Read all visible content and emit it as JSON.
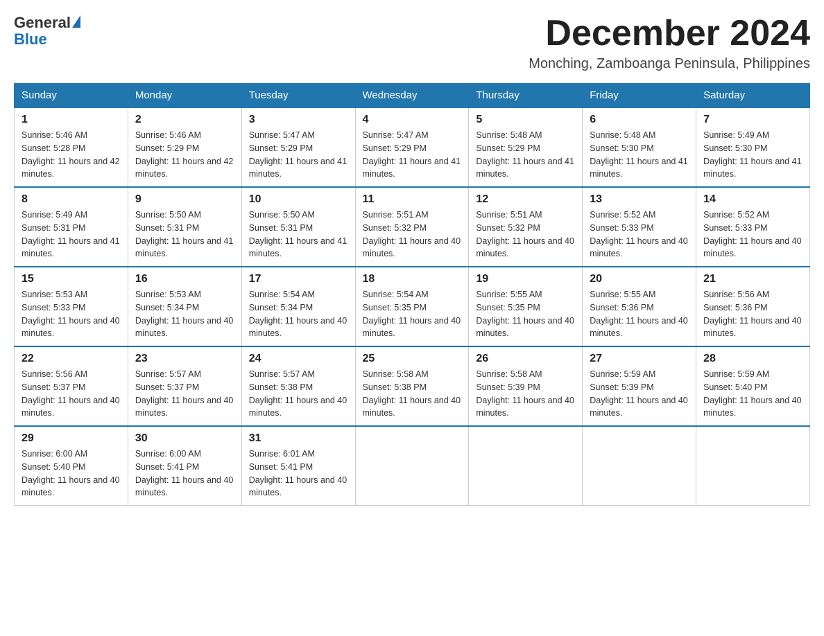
{
  "header": {
    "logo": {
      "text_general": "General",
      "triangle": "▶",
      "text_blue": "Blue"
    },
    "month_title": "December 2024",
    "location": "Monching, Zamboanga Peninsula, Philippines"
  },
  "weekdays": [
    "Sunday",
    "Monday",
    "Tuesday",
    "Wednesday",
    "Thursday",
    "Friday",
    "Saturday"
  ],
  "weeks": [
    [
      {
        "day": "1",
        "sunrise": "Sunrise: 5:46 AM",
        "sunset": "Sunset: 5:28 PM",
        "daylight": "Daylight: 11 hours and 42 minutes."
      },
      {
        "day": "2",
        "sunrise": "Sunrise: 5:46 AM",
        "sunset": "Sunset: 5:29 PM",
        "daylight": "Daylight: 11 hours and 42 minutes."
      },
      {
        "day": "3",
        "sunrise": "Sunrise: 5:47 AM",
        "sunset": "Sunset: 5:29 PM",
        "daylight": "Daylight: 11 hours and 41 minutes."
      },
      {
        "day": "4",
        "sunrise": "Sunrise: 5:47 AM",
        "sunset": "Sunset: 5:29 PM",
        "daylight": "Daylight: 11 hours and 41 minutes."
      },
      {
        "day": "5",
        "sunrise": "Sunrise: 5:48 AM",
        "sunset": "Sunset: 5:29 PM",
        "daylight": "Daylight: 11 hours and 41 minutes."
      },
      {
        "day": "6",
        "sunrise": "Sunrise: 5:48 AM",
        "sunset": "Sunset: 5:30 PM",
        "daylight": "Daylight: 11 hours and 41 minutes."
      },
      {
        "day": "7",
        "sunrise": "Sunrise: 5:49 AM",
        "sunset": "Sunset: 5:30 PM",
        "daylight": "Daylight: 11 hours and 41 minutes."
      }
    ],
    [
      {
        "day": "8",
        "sunrise": "Sunrise: 5:49 AM",
        "sunset": "Sunset: 5:31 PM",
        "daylight": "Daylight: 11 hours and 41 minutes."
      },
      {
        "day": "9",
        "sunrise": "Sunrise: 5:50 AM",
        "sunset": "Sunset: 5:31 PM",
        "daylight": "Daylight: 11 hours and 41 minutes."
      },
      {
        "day": "10",
        "sunrise": "Sunrise: 5:50 AM",
        "sunset": "Sunset: 5:31 PM",
        "daylight": "Daylight: 11 hours and 41 minutes."
      },
      {
        "day": "11",
        "sunrise": "Sunrise: 5:51 AM",
        "sunset": "Sunset: 5:32 PM",
        "daylight": "Daylight: 11 hours and 40 minutes."
      },
      {
        "day": "12",
        "sunrise": "Sunrise: 5:51 AM",
        "sunset": "Sunset: 5:32 PM",
        "daylight": "Daylight: 11 hours and 40 minutes."
      },
      {
        "day": "13",
        "sunrise": "Sunrise: 5:52 AM",
        "sunset": "Sunset: 5:33 PM",
        "daylight": "Daylight: 11 hours and 40 minutes."
      },
      {
        "day": "14",
        "sunrise": "Sunrise: 5:52 AM",
        "sunset": "Sunset: 5:33 PM",
        "daylight": "Daylight: 11 hours and 40 minutes."
      }
    ],
    [
      {
        "day": "15",
        "sunrise": "Sunrise: 5:53 AM",
        "sunset": "Sunset: 5:33 PM",
        "daylight": "Daylight: 11 hours and 40 minutes."
      },
      {
        "day": "16",
        "sunrise": "Sunrise: 5:53 AM",
        "sunset": "Sunset: 5:34 PM",
        "daylight": "Daylight: 11 hours and 40 minutes."
      },
      {
        "day": "17",
        "sunrise": "Sunrise: 5:54 AM",
        "sunset": "Sunset: 5:34 PM",
        "daylight": "Daylight: 11 hours and 40 minutes."
      },
      {
        "day": "18",
        "sunrise": "Sunrise: 5:54 AM",
        "sunset": "Sunset: 5:35 PM",
        "daylight": "Daylight: 11 hours and 40 minutes."
      },
      {
        "day": "19",
        "sunrise": "Sunrise: 5:55 AM",
        "sunset": "Sunset: 5:35 PM",
        "daylight": "Daylight: 11 hours and 40 minutes."
      },
      {
        "day": "20",
        "sunrise": "Sunrise: 5:55 AM",
        "sunset": "Sunset: 5:36 PM",
        "daylight": "Daylight: 11 hours and 40 minutes."
      },
      {
        "day": "21",
        "sunrise": "Sunrise: 5:56 AM",
        "sunset": "Sunset: 5:36 PM",
        "daylight": "Daylight: 11 hours and 40 minutes."
      }
    ],
    [
      {
        "day": "22",
        "sunrise": "Sunrise: 5:56 AM",
        "sunset": "Sunset: 5:37 PM",
        "daylight": "Daylight: 11 hours and 40 minutes."
      },
      {
        "day": "23",
        "sunrise": "Sunrise: 5:57 AM",
        "sunset": "Sunset: 5:37 PM",
        "daylight": "Daylight: 11 hours and 40 minutes."
      },
      {
        "day": "24",
        "sunrise": "Sunrise: 5:57 AM",
        "sunset": "Sunset: 5:38 PM",
        "daylight": "Daylight: 11 hours and 40 minutes."
      },
      {
        "day": "25",
        "sunrise": "Sunrise: 5:58 AM",
        "sunset": "Sunset: 5:38 PM",
        "daylight": "Daylight: 11 hours and 40 minutes."
      },
      {
        "day": "26",
        "sunrise": "Sunrise: 5:58 AM",
        "sunset": "Sunset: 5:39 PM",
        "daylight": "Daylight: 11 hours and 40 minutes."
      },
      {
        "day": "27",
        "sunrise": "Sunrise: 5:59 AM",
        "sunset": "Sunset: 5:39 PM",
        "daylight": "Daylight: 11 hours and 40 minutes."
      },
      {
        "day": "28",
        "sunrise": "Sunrise: 5:59 AM",
        "sunset": "Sunset: 5:40 PM",
        "daylight": "Daylight: 11 hours and 40 minutes."
      }
    ],
    [
      {
        "day": "29",
        "sunrise": "Sunrise: 6:00 AM",
        "sunset": "Sunset: 5:40 PM",
        "daylight": "Daylight: 11 hours and 40 minutes."
      },
      {
        "day": "30",
        "sunrise": "Sunrise: 6:00 AM",
        "sunset": "Sunset: 5:41 PM",
        "daylight": "Daylight: 11 hours and 40 minutes."
      },
      {
        "day": "31",
        "sunrise": "Sunrise: 6:01 AM",
        "sunset": "Sunset: 5:41 PM",
        "daylight": "Daylight: 11 hours and 40 minutes."
      },
      null,
      null,
      null,
      null
    ]
  ]
}
